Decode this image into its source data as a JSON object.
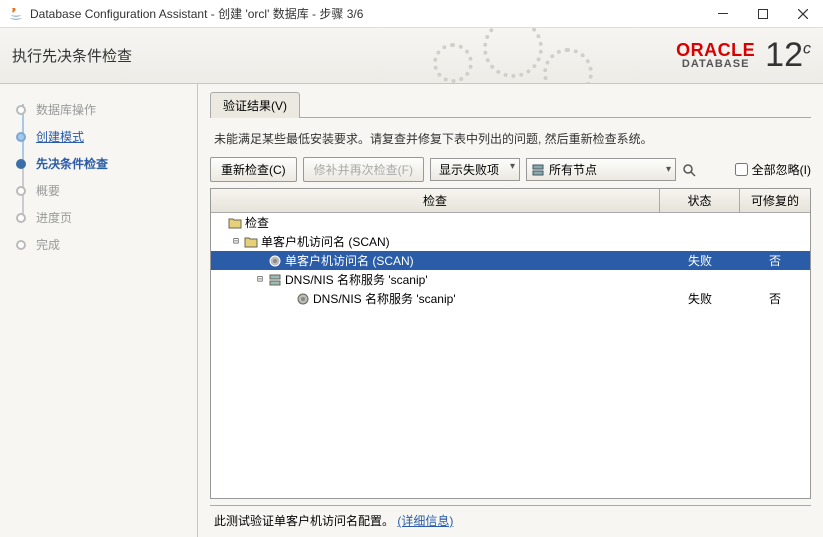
{
  "window": {
    "title": "Database Configuration Assistant - 创建 'orcl' 数据库 - 步骤 3/6"
  },
  "header": {
    "title": "执行先决条件检查",
    "brand_name": "ORACLE",
    "brand_sub": "DATABASE",
    "brand_version": "12",
    "brand_suffix": "c"
  },
  "sidebar": {
    "steps": [
      {
        "label": "数据库操作",
        "state": "done-plain"
      },
      {
        "label": "创建模式",
        "state": "done"
      },
      {
        "label": "先决条件检查",
        "state": "active"
      },
      {
        "label": "概要",
        "state": "pending"
      },
      {
        "label": "进度页",
        "state": "pending"
      },
      {
        "label": "完成",
        "state": "pending"
      }
    ]
  },
  "main": {
    "tab_label": "验证结果(V)",
    "info": "未能满足某些最低安装要求。请复查并修复下表中列出的问题, 然后重新检查系统。",
    "toolbar": {
      "recheck": "重新检查(C)",
      "fix_recheck": "修补并再次检查(F)",
      "show_failed": "显示失败项",
      "node_select": "所有节点",
      "ignore_all": "全部忽略(I)"
    },
    "columns": {
      "check": "检查",
      "status": "状态",
      "fixable": "可修复的"
    },
    "rows": [
      {
        "indent": 0,
        "toggle": "",
        "icon": "folder",
        "label": "检查",
        "status": "",
        "fix": "",
        "selected": false
      },
      {
        "indent": 1,
        "toggle": "⊟",
        "icon": "folder",
        "label": "单客户机访问名 (SCAN)",
        "status": "",
        "fix": "",
        "selected": false
      },
      {
        "indent": 2,
        "toggle": "",
        "icon": "gear",
        "label": "单客户机访问名 (SCAN)",
        "status": "失败",
        "fix": "否",
        "selected": true
      },
      {
        "indent": 3,
        "toggle": "⊟",
        "icon": "server",
        "label": "DNS/NIS 名称服务 'scanip'",
        "status": "",
        "fix": "",
        "selected": false
      },
      {
        "indent": 4,
        "toggle": "",
        "icon": "gear",
        "label": "DNS/NIS 名称服务 'scanip'",
        "status": "失败",
        "fix": "否",
        "selected": false
      }
    ],
    "footer_text": "此测试验证单客户机访问名配置。",
    "footer_link": "(详细信息)"
  }
}
